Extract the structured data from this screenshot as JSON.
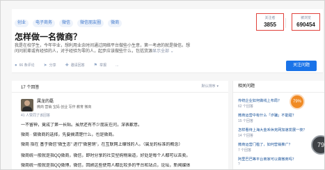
{
  "question": {
    "topics": [
      "创业",
      "电子商务",
      "微信",
      "微信朋友圈",
      "微商"
    ],
    "title": "怎样做一名微商？",
    "description_line1": "我是在校学生，今年毕业，想利用业余时间通过网络平台做些小生意，第一考虑的就是微信。想",
    "description_line2": "问问前辈或有经验的人，对于经验为零的人，起步应该做些什么，包括货源",
    "description_more": "显示全部 ⌄",
    "actions": [
      {
        "icon": "comment-icon",
        "label": "66 条评论"
      },
      {
        "icon": "share-icon",
        "label": "分享"
      },
      {
        "icon": "invite-icon",
        "label": "邀请回答"
      },
      {
        "icon": "report-icon",
        "label": "举报"
      },
      {
        "icon": "more-icon",
        "label": "..."
      }
    ],
    "followers_label": "关注者",
    "followers_value": "3855",
    "views_label": "被浏览",
    "views_value": "690454",
    "follow_button": "关注问题"
  },
  "answers": {
    "count_label": "17 个回答",
    "sort_label": "默认排序",
    "author_name": "属龙的磊",
    "author_bio": "微商 营销 宝妈 创业 写作 教育 微商",
    "voters": "41 人赞同了该回答",
    "lines": [
      "一不留神，竟成了第一长贴。虽然还有不少朋友在问，深表歉意。",
      "微商 · 做微商的选择，先要搞清楚什么，也是微商。",
      "微商 指在 基于微信\"微生态\" 进行\"微营销\"，在互联网上赚钱的人。（属龙的标准的概念）",
      "微商统一般就是指QQ微商，微信，即时分享的社交型购物渠道，好处是每个人都可以去卖。",
      "微商统一般就是指QQ微博，微信，回顾这些使用人都比较多的平台和站点，论坛，新闻媒体"
    ]
  },
  "related": {
    "header": "相关问题",
    "items": [
      {
        "title": "传统企业如何做线上布局？",
        "meta": "62 个回答"
      },
      {
        "title": "微商运营中有什么「诈骗」不能碰？",
        "meta": "15 个回答"
      },
      {
        "title": "怎样看待上海大金禾休克网加速发展一夜？",
        "meta": "14 个回答"
      },
      {
        "title": "微商运营门槛了，如何营销推广？",
        "meta": "7 个回答"
      },
      {
        "title": "阿里巴巴等平台商家可以做微商吗？",
        "meta": "?"
      }
    ]
  },
  "widgets": {
    "orange_badge": "79%",
    "gray_badge": "79"
  }
}
